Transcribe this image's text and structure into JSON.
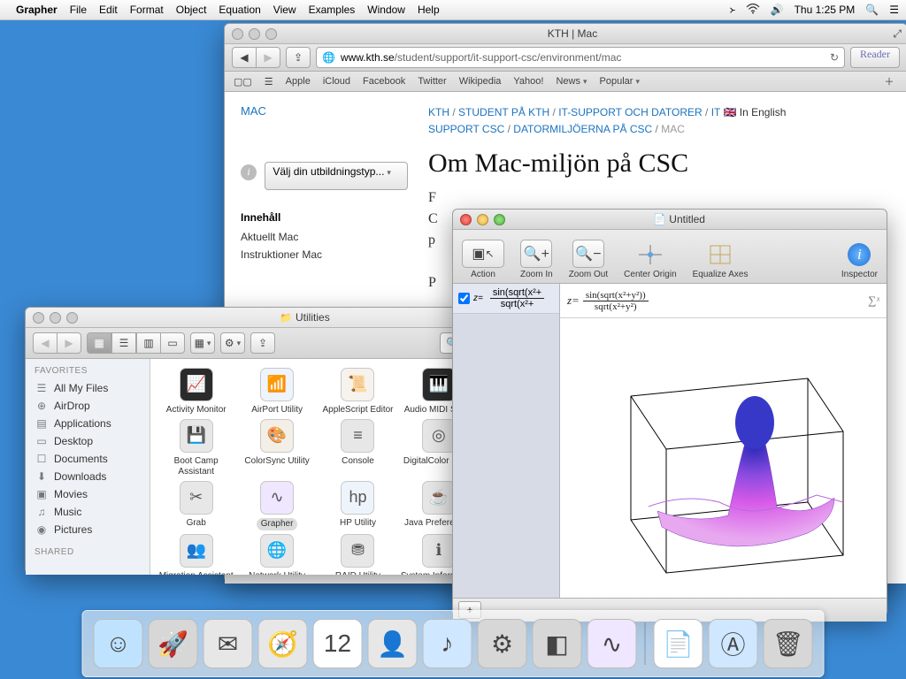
{
  "menubar": {
    "app": "Grapher",
    "items": [
      "File",
      "Edit",
      "Format",
      "Object",
      "Equation",
      "View",
      "Examples",
      "Window",
      "Help"
    ],
    "clock": "Thu 1:25 PM"
  },
  "safari": {
    "title": "KTH | Mac",
    "url_domain": "www.kth.se",
    "url_path": "/student/support/it-support-csc/environment/mac",
    "reader": "Reader",
    "bookmarks": [
      "Apple",
      "iCloud",
      "Facebook",
      "Twitter",
      "Wikipedia",
      "Yahoo!",
      "News",
      "Popular"
    ],
    "left": {
      "mac": "MAC",
      "edutype": "Välj din utbildningstyp...",
      "header": "Innehåll",
      "items": [
        "Aktuellt Mac",
        "Instruktioner Mac"
      ]
    },
    "crumbs": {
      "p1": "KTH",
      "p2": "STUDENT PÅ KTH",
      "p3": "IT-SUPPORT OCH DATORER",
      "p4": "IT",
      "eng": "In English",
      "p5": "SUPPORT CSC",
      "p6": "DATORMILJÖERNA PÅ CSC",
      "cur": "MAC"
    },
    "h1": "Om Mac-miljön på CSC",
    "para1_a": "F",
    "para1_b": "C",
    "para1_c": "p",
    "para1_d": "P"
  },
  "grapher": {
    "title": "Untitled",
    "tools": [
      "Action",
      "Zoom In",
      "Zoom Out",
      "Center Origin",
      "Equalize Axes",
      "Inspector"
    ],
    "panel_formula": "z=",
    "panel_num": "sin(sqrt(x²+",
    "panel_den": "sqrt(x²+",
    "main_prefix": "z=",
    "main_num": "sin(sqrt(x²+y²))",
    "main_den": "sqrt(x²+y²)",
    "sigma": "∑ˣ",
    "plus": "+"
  },
  "finder": {
    "title": "Utilities",
    "fav_header": "FAVORITES",
    "shared_header": "SHARED",
    "favorites": [
      {
        "g": "☰",
        "l": "All My Files"
      },
      {
        "g": "⊕",
        "l": "AirDrop"
      },
      {
        "g": "▤",
        "l": "Applications"
      },
      {
        "g": "▭",
        "l": "Desktop"
      },
      {
        "g": "☐",
        "l": "Documents"
      },
      {
        "g": "⬇",
        "l": "Downloads"
      },
      {
        "g": "▣",
        "l": "Movies"
      },
      {
        "g": "♫",
        "l": "Music"
      },
      {
        "g": "◉",
        "l": "Pictures"
      }
    ],
    "items": [
      {
        "l": "Activity Monitor",
        "g": "📈",
        "b": "#2b2b2b"
      },
      {
        "l": "AirPort Utility",
        "g": "📶",
        "b": "#eef4fb"
      },
      {
        "l": "AppleScript Editor",
        "g": "📜",
        "b": "#f6f3ee"
      },
      {
        "l": "Audio MIDI Setup",
        "g": "🎹",
        "b": "#2b2b2b"
      },
      {
        "l": "",
        "g": "",
        "b": "transparent"
      },
      {
        "l": "Boot Camp Assistant",
        "g": "💾",
        "b": "#e7e7e7"
      },
      {
        "l": "ColorSync Utility",
        "g": "🎨",
        "b": "#f3efe6"
      },
      {
        "l": "Console",
        "g": "≡",
        "b": "#e7e7e7"
      },
      {
        "l": "DigitalColor Meter",
        "g": "◎",
        "b": "#e7e7e7"
      },
      {
        "l": "",
        "g": "",
        "b": "transparent"
      },
      {
        "l": "Grab",
        "g": "✂",
        "b": "#e7e7e7"
      },
      {
        "l": "Grapher",
        "g": "∿",
        "b": "#efe6ff",
        "sel": true
      },
      {
        "l": "HP Utility",
        "g": "hp",
        "b": "#eef4fb"
      },
      {
        "l": "Java Preferences",
        "g": "☕",
        "b": "#e7e7e7"
      },
      {
        "l": "",
        "g": "",
        "b": "transparent"
      },
      {
        "l": "Migration Assistant",
        "g": "👥",
        "b": "#e7e7e7"
      },
      {
        "l": "Network Utility",
        "g": "🌐",
        "b": "#e7e7e7"
      },
      {
        "l": "RAID Utility",
        "g": "⛃",
        "b": "#e7e7e7"
      },
      {
        "l": "System Information",
        "g": "ℹ",
        "b": "#e7e7e7"
      },
      {
        "l": "",
        "g": "",
        "b": "transparent"
      }
    ]
  },
  "dock": {
    "items": [
      {
        "g": "☺",
        "b": "#bfe3ff"
      },
      {
        "g": "🚀",
        "b": "#d7d7d7"
      },
      {
        "g": "✉",
        "b": "#e7e7e7"
      },
      {
        "g": "🧭",
        "b": "#e7e7e7"
      },
      {
        "g": "12",
        "b": "#fff"
      },
      {
        "g": "👤",
        "b": "#e7e7e7"
      },
      {
        "g": "♪",
        "b": "#cfe7ff"
      },
      {
        "g": "⚙",
        "b": "#d7d7d7"
      },
      {
        "g": "◧",
        "b": "#d7d7d7"
      },
      {
        "g": "∿",
        "b": "#efe6ff"
      }
    ],
    "right": [
      {
        "g": "📄",
        "b": "#fff"
      },
      {
        "g": "Ⓐ",
        "b": "#cfe7ff"
      },
      {
        "g": "🗑",
        "b": "#d7d7d7"
      }
    ]
  }
}
